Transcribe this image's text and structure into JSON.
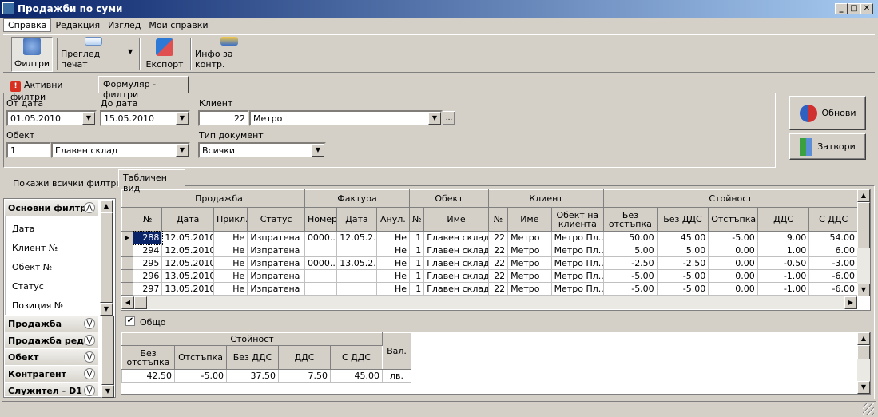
{
  "window": {
    "title": "Продажби по суми",
    "minimize": "_",
    "maximize": "□",
    "close": "✕"
  },
  "menu": [
    "Справка",
    "Редакция",
    "Изглед",
    "Мои справки"
  ],
  "toolbar": {
    "filters": "Филтри",
    "print_preview": "Преглед печат",
    "export": "Експорт",
    "info": "Инфо за контр."
  },
  "tabs": {
    "active_filters": "Активни филтри",
    "form_filters": "Формуляр - филтри",
    "table_view": "Табличен вид"
  },
  "form": {
    "from_date_label": "От дата",
    "from_date": "01.05.2010",
    "to_date_label": "До дата",
    "to_date": "15.05.2010",
    "client_label": "Клиент",
    "client_no": "22",
    "client_name": "Метро",
    "object_label": "Обект",
    "object_no": "1",
    "object_name": "Главен склад",
    "doc_type_label": "Тип документ",
    "doc_type": "Всички",
    "ellipsis": "..."
  },
  "buttons": {
    "refresh": "Обнови",
    "close": "Затвори"
  },
  "left_panel": {
    "show_all": "Покажи всички филтри",
    "main_category": "Основни филтри",
    "main_items": [
      "Дата",
      "Клиент №",
      "Обект №",
      "Статус",
      "Позиция №"
    ],
    "categories": [
      "Продажба",
      "Продажба ред",
      "Обект",
      "Контрагент",
      "Служител - D1"
    ]
  },
  "grid": {
    "group_headers": [
      "Продажба",
      "Фактура",
      "Обект",
      "Клиент",
      "Стойност"
    ],
    "columns": [
      "№",
      "Дата",
      "Прикл.",
      "Статус",
      "Номер",
      "Дата",
      "Анул.",
      "№",
      "Име",
      "№",
      "Име",
      "Обект на клиента",
      "Без отстъпка",
      "Без ДДС",
      "Отстъпка",
      "ДДС",
      "С ДДС"
    ],
    "rows": [
      [
        "288",
        "12.05.2010",
        "Не",
        "Изпратена",
        "0000...",
        "12.05.2...",
        "Не",
        "1",
        "Главен склад",
        "22",
        "Метро",
        "Метро Пл...",
        "50.00",
        "45.00",
        "-5.00",
        "9.00",
        "54.00"
      ],
      [
        "294",
        "12.05.2010",
        "Не",
        "Изпратена",
        "",
        "",
        "Не",
        "1",
        "Главен склад",
        "22",
        "Метро",
        "Метро Пл...",
        "5.00",
        "5.00",
        "0.00",
        "1.00",
        "6.00"
      ],
      [
        "295",
        "12.05.2010",
        "Не",
        "Изпратена",
        "0000...",
        "13.05.2...",
        "Не",
        "1",
        "Главен склад",
        "22",
        "Метро",
        "Метро Пл...",
        "-2.50",
        "-2.50",
        "0.00",
        "-0.50",
        "-3.00"
      ],
      [
        "296",
        "13.05.2010",
        "Не",
        "Изпратена",
        "",
        "",
        "Не",
        "1",
        "Главен склад",
        "22",
        "Метро",
        "Метро Пл...",
        "-5.00",
        "-5.00",
        "0.00",
        "-1.00",
        "-6.00"
      ],
      [
        "297",
        "13.05.2010",
        "Не",
        "Изпратена",
        "",
        "",
        "Не",
        "1",
        "Главен склад",
        "22",
        "Метро",
        "Метро Пл...",
        "-5.00",
        "-5.00",
        "0.00",
        "-1.00",
        "-6.00"
      ]
    ]
  },
  "totals": {
    "checkbox_label": "Общо",
    "checked": true,
    "group_header": "Стойност",
    "columns": [
      "Без отстъпка",
      "Отстъпка",
      "Без ДДС",
      "ДДС",
      "С ДДС",
      "Вал."
    ],
    "values": [
      "42.50",
      "-5.00",
      "37.50",
      "7.50",
      "45.00",
      "лв."
    ]
  },
  "glyphs": {
    "dropdown": "▼",
    "up": "▲",
    "down": "▼",
    "left": "◀",
    "right": "▶",
    "collapse": "⋀",
    "expand": "⋁",
    "row_marker": "▶",
    "check": "✔",
    "warn": "!"
  },
  "colors": {
    "title_start": "#0a246a",
    "title_end": "#a6caf0",
    "face": "#d4d0c8",
    "selection": "#0a246a"
  }
}
